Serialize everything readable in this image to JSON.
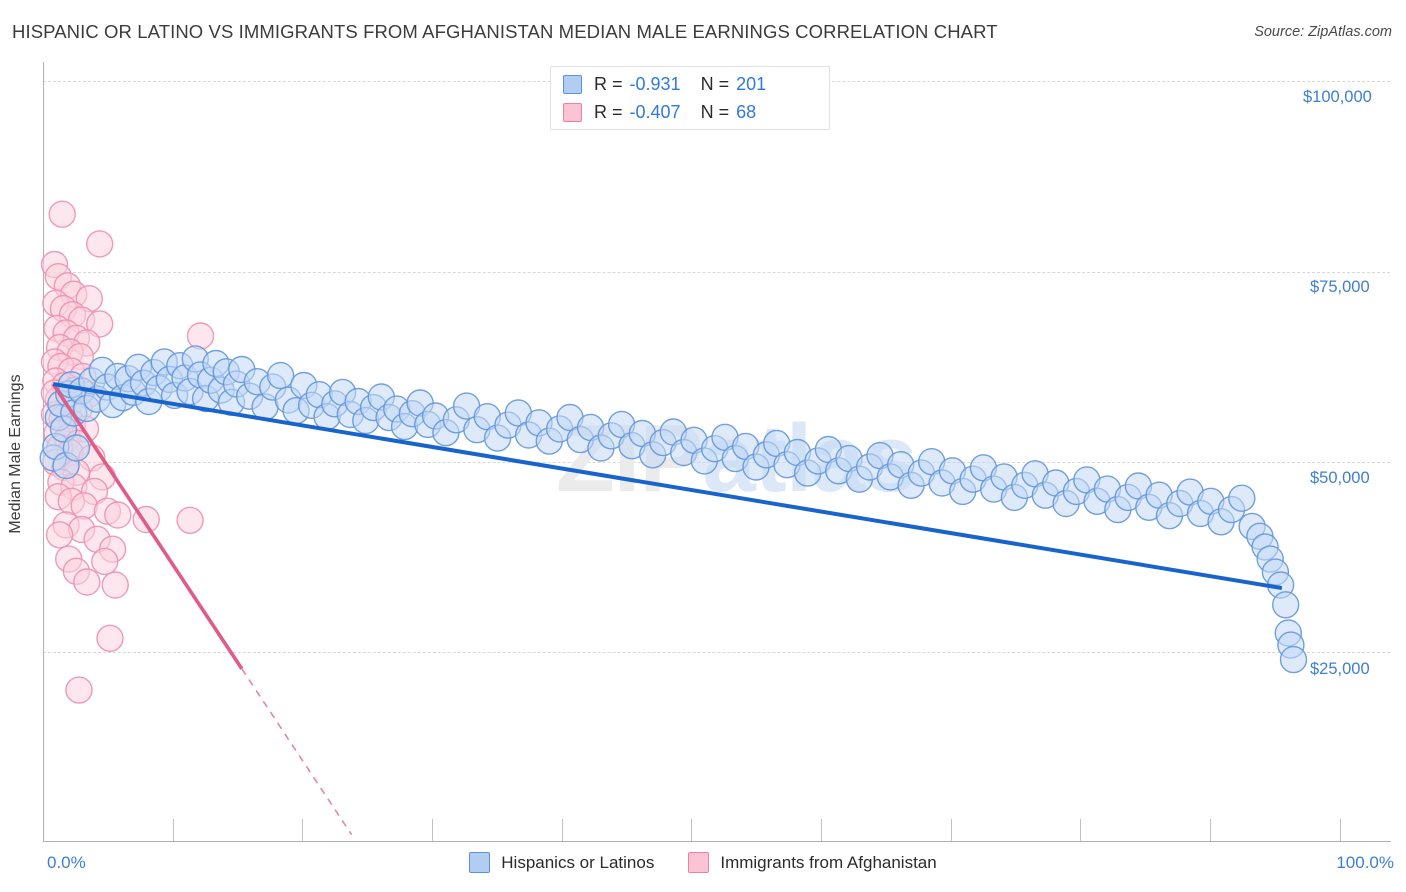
{
  "header": {
    "title": "HISPANIC OR LATINO VS IMMIGRANTS FROM AFGHANISTAN MEDIAN MALE EARNINGS CORRELATION CHART",
    "source": "Source: ZipAtlas.com"
  },
  "watermark": {
    "part1": "ZIP",
    "part2": "atlas"
  },
  "axes": {
    "ylabel": "Median Male Earnings",
    "y_ticks": [
      "$100,000",
      "$75,000",
      "$50,000",
      "$25,000"
    ],
    "x_min_label": "0.0%",
    "x_max_label": "100.0%"
  },
  "stats_legend": {
    "rows": [
      {
        "color": "#b2cdf2",
        "r_key": "R =",
        "r_value": "-0.931",
        "n_key": "N =",
        "n_value": "201"
      },
      {
        "color": "#fac4d4",
        "r_key": "R =",
        "r_value": "-0.407",
        "n_key": "N =",
        "n_value": "68"
      }
    ]
  },
  "series_legend": [
    {
      "label": "Hispanics or Latinos",
      "color": "#b2cdf2",
      "border": "#5b92e0"
    },
    {
      "label": "Immigrants from Afghanistan",
      "color": "#fac4d4",
      "border": "#ef7fa5"
    }
  ],
  "colors": {
    "blue_fill": "#c3d9f5",
    "blue_stroke": "#6396dd",
    "blue_trend": "#1764cc",
    "pink_fill": "#fbd2de",
    "pink_stroke": "#f08fae",
    "pink_trend": "#e05c86",
    "tick_text": "#3f7fd0",
    "grid": "#d8d8d8"
  },
  "chart_data": {
    "type": "scatter",
    "title": "HISPANIC OR LATINO VS IMMIGRANTS FROM AFGHANISTAN MEDIAN MALE EARNINGS CORRELATION CHART",
    "xlabel": "",
    "ylabel": "Median Male Earnings",
    "xlim": [
      0,
      100
    ],
    "ylim": [
      0,
      105000
    ],
    "xtick_labels": [
      "0.0%",
      "100.0%"
    ],
    "ytick_values": [
      25000,
      50000,
      75000,
      100000
    ],
    "grid": true,
    "legend_position": "bottom-center",
    "series": [
      {
        "name": "Hispanics or Latinos",
        "r": -0.931,
        "n": 201,
        "fill": "#c3d9f5",
        "stroke": "#6396dd",
        "trend": {
          "x0": 0.4,
          "y0": 60200,
          "x1": 95.5,
          "y1": 33400,
          "style": "solid"
        },
        "points": [
          [
            0.4,
            50500
          ],
          [
            0.6,
            52000
          ],
          [
            0.8,
            55800
          ],
          [
            1.0,
            57600
          ],
          [
            1.2,
            54300
          ],
          [
            1.4,
            49500
          ],
          [
            1.6,
            58900
          ],
          [
            1.8,
            60100
          ],
          [
            2.0,
            56400
          ],
          [
            2.2,
            51800
          ],
          [
            2.6,
            59300
          ],
          [
            3.0,
            57000
          ],
          [
            3.4,
            60600
          ],
          [
            3.8,
            58200
          ],
          [
            4.2,
            62000
          ],
          [
            4.6,
            59800
          ],
          [
            5.0,
            57500
          ],
          [
            5.4,
            61200
          ],
          [
            5.8,
            58400
          ],
          [
            6.2,
            60900
          ],
          [
            6.6,
            59100
          ],
          [
            7.0,
            62400
          ],
          [
            7.4,
            60300
          ],
          [
            7.8,
            57900
          ],
          [
            8.2,
            61700
          ],
          [
            8.6,
            59600
          ],
          [
            9.0,
            63100
          ],
          [
            9.4,
            60800
          ],
          [
            9.8,
            58700
          ],
          [
            10.2,
            62600
          ],
          [
            10.6,
            61000
          ],
          [
            11.0,
            59200
          ],
          [
            11.4,
            63500
          ],
          [
            11.8,
            61400
          ],
          [
            12.2,
            58300
          ],
          [
            12.6,
            60700
          ],
          [
            13.0,
            62900
          ],
          [
            13.4,
            59400
          ],
          [
            13.8,
            61800
          ],
          [
            14.2,
            57800
          ],
          [
            14.6,
            60200
          ],
          [
            15.0,
            62100
          ],
          [
            15.6,
            58600
          ],
          [
            16.2,
            60500
          ],
          [
            16.8,
            57200
          ],
          [
            17.4,
            59800
          ],
          [
            18.0,
            61300
          ],
          [
            18.6,
            58100
          ],
          [
            19.2,
            56700
          ],
          [
            19.8,
            60000
          ],
          [
            20.4,
            57400
          ],
          [
            21.0,
            58800
          ],
          [
            21.6,
            55900
          ],
          [
            22.2,
            57600
          ],
          [
            22.8,
            59100
          ],
          [
            23.4,
            56200
          ],
          [
            24.0,
            57900
          ],
          [
            24.6,
            55400
          ],
          [
            25.2,
            57100
          ],
          [
            25.8,
            58500
          ],
          [
            26.4,
            55800
          ],
          [
            27.0,
            56900
          ],
          [
            27.6,
            54600
          ],
          [
            28.2,
            56300
          ],
          [
            28.8,
            57700
          ],
          [
            29.4,
            54900
          ],
          [
            30.0,
            56000
          ],
          [
            30.8,
            53800
          ],
          [
            31.6,
            55500
          ],
          [
            32.4,
            57300
          ],
          [
            33.2,
            54200
          ],
          [
            34.0,
            55900
          ],
          [
            34.8,
            53100
          ],
          [
            35.6,
            54800
          ],
          [
            36.4,
            56400
          ],
          [
            37.2,
            53500
          ],
          [
            38.0,
            55100
          ],
          [
            38.8,
            52700
          ],
          [
            39.6,
            54300
          ],
          [
            40.4,
            55800
          ],
          [
            41.2,
            52900
          ],
          [
            42.0,
            54500
          ],
          [
            42.8,
            51800
          ],
          [
            43.6,
            53400
          ],
          [
            44.4,
            54900
          ],
          [
            45.2,
            52100
          ],
          [
            46.0,
            53700
          ],
          [
            46.8,
            50900
          ],
          [
            47.6,
            52500
          ],
          [
            48.4,
            53900
          ],
          [
            49.2,
            51200
          ],
          [
            50.0,
            52800
          ],
          [
            50.8,
            50100
          ],
          [
            51.6,
            51700
          ],
          [
            52.4,
            53200
          ],
          [
            53.2,
            50400
          ],
          [
            54.0,
            52000
          ],
          [
            54.8,
            49300
          ],
          [
            55.6,
            50900
          ],
          [
            56.4,
            52400
          ],
          [
            57.2,
            49600
          ],
          [
            58.0,
            51200
          ],
          [
            58.8,
            48500
          ],
          [
            59.6,
            50100
          ],
          [
            60.4,
            51600
          ],
          [
            61.2,
            48800
          ],
          [
            62.0,
            50400
          ],
          [
            62.8,
            47700
          ],
          [
            63.6,
            49300
          ],
          [
            64.4,
            50800
          ],
          [
            65.2,
            48000
          ],
          [
            66.0,
            49600
          ],
          [
            66.8,
            46900
          ],
          [
            67.6,
            48500
          ],
          [
            68.4,
            50000
          ],
          [
            69.2,
            47200
          ],
          [
            70.0,
            48800
          ],
          [
            70.8,
            46100
          ],
          [
            71.6,
            47700
          ],
          [
            72.4,
            49200
          ],
          [
            73.2,
            46400
          ],
          [
            74.0,
            48000
          ],
          [
            74.8,
            45300
          ],
          [
            75.6,
            46900
          ],
          [
            76.4,
            48400
          ],
          [
            77.2,
            45600
          ],
          [
            78.0,
            47200
          ],
          [
            78.8,
            44500
          ],
          [
            79.6,
            46100
          ],
          [
            80.4,
            47600
          ],
          [
            81.2,
            44800
          ],
          [
            82.0,
            46400
          ],
          [
            82.8,
            43700
          ],
          [
            83.6,
            45300
          ],
          [
            84.4,
            46800
          ],
          [
            85.2,
            44000
          ],
          [
            86.0,
            45600
          ],
          [
            86.8,
            42900
          ],
          [
            87.6,
            44500
          ],
          [
            88.4,
            46000
          ],
          [
            89.2,
            43200
          ],
          [
            90.0,
            44800
          ],
          [
            90.8,
            42100
          ],
          [
            91.6,
            43700
          ],
          [
            92.4,
            45200
          ],
          [
            93.2,
            41500
          ],
          [
            93.8,
            40200
          ],
          [
            94.2,
            38800
          ],
          [
            94.6,
            37200
          ],
          [
            95.0,
            35500
          ],
          [
            95.4,
            33800
          ],
          [
            95.8,
            31200
          ],
          [
            96.0,
            27500
          ],
          [
            96.2,
            25900
          ],
          [
            96.4,
            24000
          ]
        ]
      },
      {
        "name": "Immigrants from Afghanistan",
        "r": -0.407,
        "n": 68,
        "fill": "#fbd2de",
        "stroke": "#f08fae",
        "trend": {
          "x0": 0.4,
          "y0": 60200,
          "x1": 15.0,
          "y1": 22800,
          "style": "solid"
        },
        "trend_extension": {
          "x0": 15.0,
          "y0": 22800,
          "x1": 23.5,
          "y1": 1000,
          "style": "dashed"
        },
        "points": [
          [
            1.1,
            82500
          ],
          [
            4.0,
            78600
          ],
          [
            0.5,
            75900
          ],
          [
            0.8,
            74300
          ],
          [
            1.5,
            73100
          ],
          [
            2.0,
            72000
          ],
          [
            3.2,
            71400
          ],
          [
            0.6,
            70800
          ],
          [
            1.2,
            70100
          ],
          [
            1.9,
            69300
          ],
          [
            2.6,
            68600
          ],
          [
            4.0,
            68100
          ],
          [
            0.7,
            67500
          ],
          [
            1.4,
            66900
          ],
          [
            2.2,
            66200
          ],
          [
            3.0,
            65600
          ],
          [
            0.9,
            65000
          ],
          [
            1.7,
            64400
          ],
          [
            2.5,
            63800
          ],
          [
            11.8,
            66500
          ],
          [
            0.5,
            63100
          ],
          [
            1.0,
            62500
          ],
          [
            1.8,
            61900
          ],
          [
            2.7,
            61200
          ],
          [
            0.6,
            60600
          ],
          [
            1.3,
            60000
          ],
          [
            2.1,
            59400
          ],
          [
            3.1,
            58800
          ],
          [
            0.8,
            58100
          ],
          [
            1.6,
            57500
          ],
          [
            2.4,
            56900
          ],
          [
            0.5,
            56200
          ],
          [
            1.1,
            55600
          ],
          [
            1.9,
            55000
          ],
          [
            2.9,
            54300
          ],
          [
            0.7,
            53700
          ],
          [
            1.5,
            53100
          ],
          [
            2.3,
            52400
          ],
          [
            0.9,
            51800
          ],
          [
            1.7,
            51200
          ],
          [
            3.4,
            50500
          ],
          [
            0.6,
            49900
          ],
          [
            1.3,
            49200
          ],
          [
            2.2,
            48600
          ],
          [
            4.2,
            48000
          ],
          [
            1.0,
            47300
          ],
          [
            2.0,
            46700
          ],
          [
            3.6,
            46100
          ],
          [
            0.8,
            45400
          ],
          [
            1.8,
            44800
          ],
          [
            2.8,
            44200
          ],
          [
            4.6,
            43500
          ],
          [
            5.4,
            43000
          ],
          [
            7.6,
            42400
          ],
          [
            11.0,
            42300
          ],
          [
            1.4,
            41700
          ],
          [
            2.6,
            41100
          ],
          [
            0.9,
            40400
          ],
          [
            3.8,
            39800
          ],
          [
            5.0,
            38500
          ],
          [
            1.6,
            37200
          ],
          [
            4.4,
            36900
          ],
          [
            2.2,
            35600
          ],
          [
            3.0,
            34200
          ],
          [
            5.2,
            33800
          ],
          [
            4.8,
            26800
          ],
          [
            2.4,
            20000
          ],
          [
            0.5,
            59000
          ]
        ]
      }
    ]
  }
}
